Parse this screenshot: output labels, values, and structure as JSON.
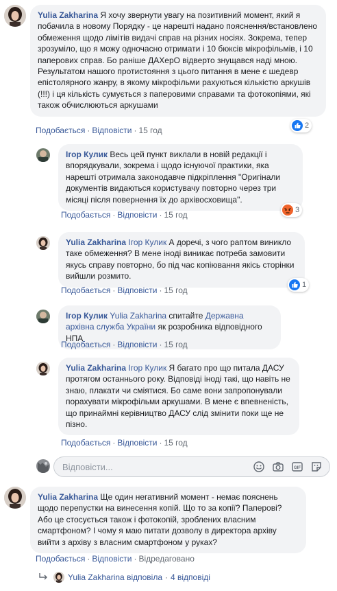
{
  "actions": {
    "like": "Подобається",
    "reply": "Відповісти",
    "sep": "·"
  },
  "comments": [
    {
      "author": "Yulia Zakharina",
      "text": "Я хочу звернути увагу на позитивний момент, який я побачила в новому Порядку - це нарешті надано пояснення/встановлено обмеження щодо лімітів видачі справ на різних носіях. Зокрема, тепер зрозуміло, що я можу одночасно отримати і 10 бюксів мікрофільмів, і 10 паперових справ. Бо раніше ДАХерО відверто знущався наді мною. Результатом нашого протистояння з цього питання в мене є шедевр епістолярного жанру, в якому мікрофільми рахуються кількістю аркушів (!!!) і ця кількість сумується з паперовими справами та фотокопіями, які також обчислюються аркушами",
      "time": "15 год",
      "reactions": "2"
    },
    {
      "author": "Ігор Кулик",
      "text": "Весь цей пункт виклали в новій редакції і впорядкували, зокрема і щодо існуючої практики, яка нарешті отримала законодавче підкріплення \"Оригінали документів видаються користувачу повторно через три місяці після повернення їх до архівосховища\".",
      "time": "15 год",
      "reactions": "3"
    },
    {
      "author": "Yulia Zakharina",
      "mention": "Ігор Кулик",
      "text": "А доречі, з чого раптом виникло таке обмеження? В мене іноді виникає потреба замовити якусь справу повторно, бо під час копіювання якісь сторінки вийшли розмито.",
      "time": "15 год",
      "reactions": "1"
    },
    {
      "author": "Ігор Кулик",
      "mention": "Yulia Zakharina",
      "text_a": "спитайте",
      "link": "Державна архівна служба України",
      "text_b": "як розробника відповідного НПА",
      "time": "15 год"
    },
    {
      "author": "Yulia Zakharina",
      "mention": "Ігор Кулик",
      "text": "Я багато про що питала ДАСУ протягом останнього року. Відповіді іноді такі, що навіть не знаю, плакати чи сміятися. Бо саме вони запропонували порахувати мікрофільми аркушами. В мене є впевненість, що принаймні керівництво ДАСУ слід змінити поки ще не пізно.",
      "time": "15 год"
    },
    {
      "author": "Yulia Zakharina",
      "text": "Ще один негативний момент - немає пояснень щодо перепустки на винесення копій. Що то за копії? Паперові? Або це стосується також і фотокопій, зроблених власним смартфоном? І чому я маю питати дозволу в директора архіву вийти з архіву з власним смартфоном у руках?",
      "edited": "Відредаговано"
    }
  ],
  "reply_box": {
    "placeholder": "Відповісти..."
  },
  "replies_summary": {
    "author": "Yulia Zakharina",
    "verb": "відповіла",
    "count": "4 відповіді"
  },
  "colors": {
    "link": "#385898",
    "bubble": "#f2f3f5",
    "meta": "#606770"
  },
  "icons": [
    "like-icon",
    "angry-icon",
    "emoji-icon",
    "camera-icon",
    "gif-icon",
    "sticker-icon",
    "reply-arrow-icon"
  ]
}
